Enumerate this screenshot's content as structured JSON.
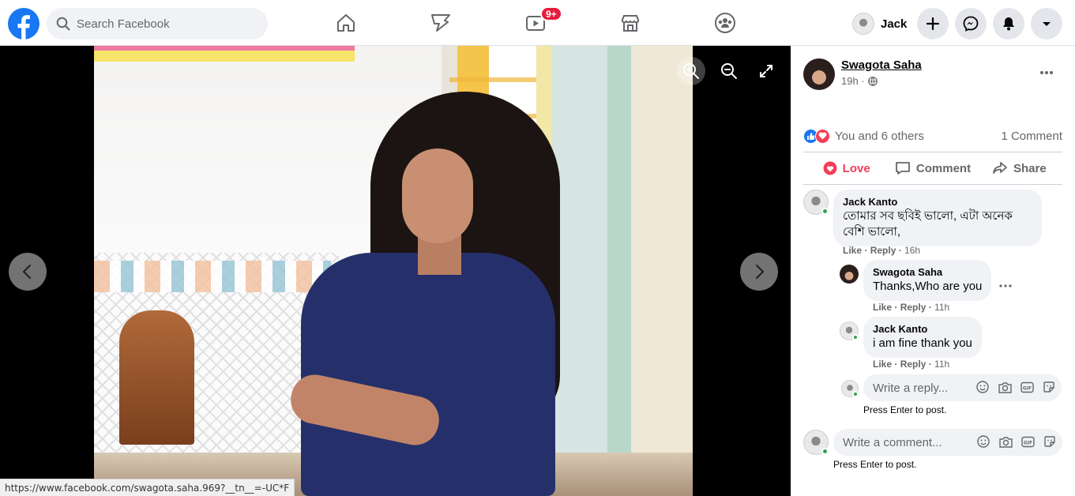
{
  "topbar": {
    "search_placeholder": "Search Facebook",
    "watch_badge": "9+",
    "profile_name": "Jack"
  },
  "status_url": "https://www.facebook.com/swagota.saha.969?__tn__=-UC*F",
  "post": {
    "author": "Swagota Saha",
    "time": "19h ·",
    "reactions_text": "You and 6 others",
    "comment_count": "1 Comment",
    "actions": {
      "love": "Love",
      "comment": "Comment",
      "share": "Share"
    }
  },
  "comments": [
    {
      "name": "Jack Kanto",
      "text_line1": "তোমার সব ছবিই ভালো, এটা অনেক",
      "text_line2": "বেশি ভালো,",
      "like": "Like",
      "reply": "Reply",
      "time": "16h"
    }
  ],
  "replies": [
    {
      "name": "Swagota Saha",
      "text": "Thanks,Who are you",
      "like": "Like",
      "reply": "Reply",
      "time": "11h"
    },
    {
      "name": "Jack Kanto",
      "text": "i am fine thank you",
      "like": "Like",
      "reply": "Reply",
      "time": "11h"
    }
  ],
  "reply_box": {
    "placeholder": "Write a reply...",
    "hint": "Press Enter to post."
  },
  "comment_box": {
    "placeholder": "Write a comment...",
    "hint": "Press Enter to post."
  },
  "colors": {
    "brand": "#1877f2",
    "love": "#f33e58",
    "badge": "#e41e3f",
    "online": "#31a24c"
  }
}
